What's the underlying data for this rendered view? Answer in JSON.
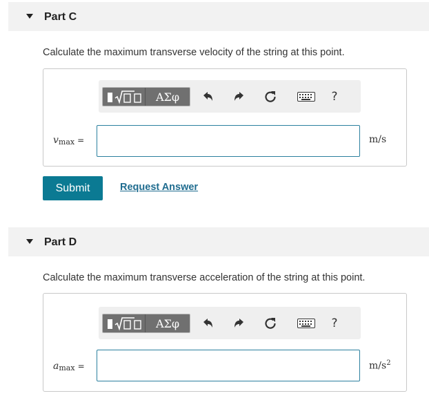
{
  "parts": [
    {
      "title": "Part C",
      "question": "Calculate the maximum transverse velocity of the string at this point.",
      "variable": "v",
      "subscript": "max",
      "equals": "=",
      "unit": "m/s",
      "unit_exponent": "",
      "input_value": "",
      "submit_label": "Submit",
      "request_label": "Request Answer"
    },
    {
      "title": "Part D",
      "question": "Calculate the maximum transverse acceleration of the string at this point.",
      "variable": "a",
      "subscript": "max",
      "equals": "=",
      "unit": "m/s",
      "unit_exponent": "2",
      "input_value": ""
    }
  ],
  "toolbar": {
    "greek_label": "ΑΣφ",
    "help_label": "?",
    "icons": [
      "templates-icon",
      "undo-icon",
      "redo-icon",
      "reset-icon",
      "keyboard-icon",
      "help-icon"
    ]
  },
  "colors": {
    "header_bg": "#f2f2f2",
    "submit_bg": "#0b7a93",
    "link": "#1f6c8f",
    "input_border": "#2a7f9e",
    "toolbar_btn": "#707070"
  }
}
